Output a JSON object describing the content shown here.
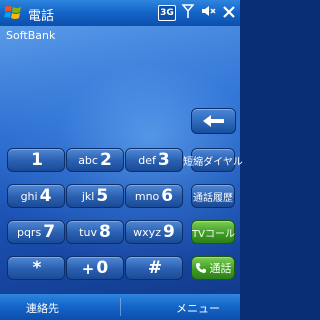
{
  "title_bar": {
    "title": "電話",
    "network_badge": "3G",
    "icons": [
      "windows-start-icon",
      "signal-icon",
      "speaker-icon",
      "close-icon"
    ]
  },
  "carrier": "SoftBank",
  "keypad": [
    {
      "letters": "",
      "num": "1"
    },
    {
      "letters": "abc",
      "num": "2"
    },
    {
      "letters": "def",
      "num": "3"
    },
    {
      "letters": "ghi",
      "num": "4"
    },
    {
      "letters": "jkl",
      "num": "5"
    },
    {
      "letters": "mno",
      "num": "6"
    },
    {
      "letters": "pqrs",
      "num": "7"
    },
    {
      "letters": "tuv",
      "num": "8"
    },
    {
      "letters": "wxyz",
      "num": "9"
    },
    {
      "letters": "",
      "num": "*"
    },
    {
      "letters": "+",
      "num": "0"
    },
    {
      "letters": "",
      "num": "#"
    }
  ],
  "function_keys": {
    "speed_dial": "短縮ダイヤル",
    "call_history": "通話履歴",
    "tv_call": "TVコール",
    "call": "通話"
  },
  "softkeys": {
    "left": "連絡先",
    "right": "メニュー"
  },
  "colors": {
    "title_bar": "#1566c9",
    "key_blue": "#2a5fb0",
    "key_green": "#3e9d25"
  }
}
